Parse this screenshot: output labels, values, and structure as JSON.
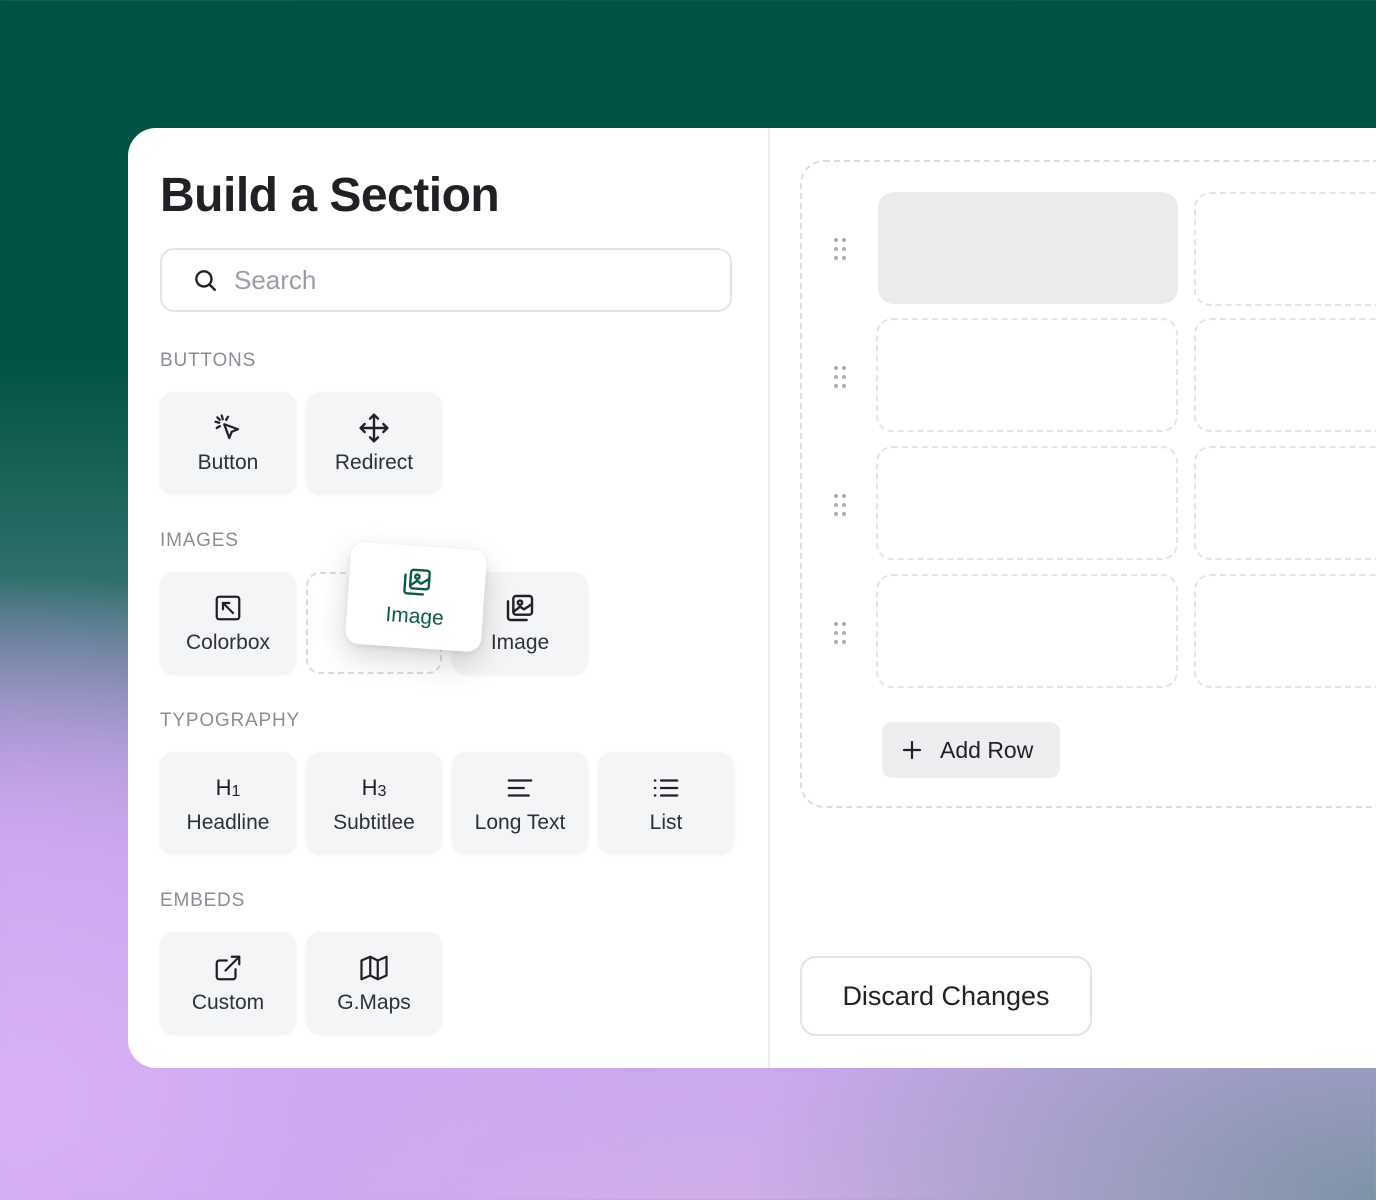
{
  "panel": {
    "title": "Build a Section",
    "search": {
      "placeholder": "Search"
    }
  },
  "sections": {
    "buttons": {
      "label": "BUTTONS",
      "items": [
        {
          "label": "Button",
          "icon": "cursor-click-icon"
        },
        {
          "label": "Redirect",
          "icon": "move-arrows-icon"
        }
      ]
    },
    "images": {
      "label": "IMAGES",
      "items": [
        {
          "label": "Colorbox",
          "icon": "expand-box-icon"
        },
        {
          "label": "Image",
          "icon": "image-stack-icon",
          "state": "dragging"
        },
        {
          "label": "Image",
          "icon": "image-stack-icon"
        }
      ]
    },
    "typography": {
      "label": "TYPOGRAPHY",
      "items": [
        {
          "label": "Headline",
          "icon": "h1-icon",
          "icon_text": "H",
          "icon_sub": "1"
        },
        {
          "label": "Subtitlee",
          "icon": "h3-icon",
          "icon_text": "H",
          "icon_sub": "3"
        },
        {
          "label": "Long Text",
          "icon": "align-left-icon"
        },
        {
          "label": "List",
          "icon": "list-icon"
        }
      ]
    },
    "embeds": {
      "label": "EMBEDS",
      "items": [
        {
          "label": "Custom",
          "icon": "external-link-icon"
        },
        {
          "label": "G.Maps",
          "icon": "map-icon"
        }
      ]
    }
  },
  "canvas": {
    "add_row_label": "Add Row",
    "discard_label": "Discard Changes"
  },
  "colors": {
    "brand_dark_green": "#005443",
    "accent_text_green": "#0b5a49",
    "tile_bg": "#f4f5f6"
  }
}
